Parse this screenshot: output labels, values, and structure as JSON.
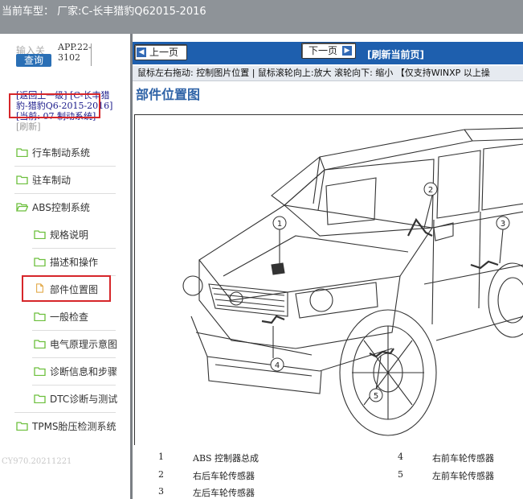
{
  "title_bar": {
    "text": "当前车型： 厂家:C-长丰猎豹Q62015-2016"
  },
  "sidebar": {
    "search_placeholder": "输入关",
    "search_button": "查询",
    "app_code": "APP.22-3102",
    "breadcrumb": {
      "back": "[返回上一级]  [C-长丰猎豹-猎豹Q6-2015-2016]",
      "current": "[当前: 07 制动系统]",
      "refresh": "[刷新]"
    },
    "tree": [
      {
        "label": "行车制动系统",
        "level": 0,
        "type": "folder"
      },
      {
        "label": "驻车制动",
        "level": 0,
        "type": "folder"
      },
      {
        "label": "ABS控制系统",
        "level": 0,
        "type": "folder-open",
        "highlighted": true
      },
      {
        "label": "规格说明",
        "level": 1,
        "type": "folder"
      },
      {
        "label": "描述和操作",
        "level": 1,
        "type": "folder"
      },
      {
        "label": "部件位置图",
        "level": 1,
        "type": "page",
        "highlighted": true
      },
      {
        "label": "一般检查",
        "level": 1,
        "type": "folder"
      },
      {
        "label": "电气原理示意图",
        "level": 1,
        "type": "folder"
      },
      {
        "label": "诊断信息和步骤",
        "level": 1,
        "type": "folder"
      },
      {
        "label": "DTC诊断与测试",
        "level": 1,
        "type": "folder"
      },
      {
        "label": "TPMS胎压检测系统",
        "level": 0,
        "type": "folder"
      }
    ],
    "footer": "CY970.20211221"
  },
  "main": {
    "prev_button": "上一页",
    "next_button": "下一页",
    "refresh_link": "[刷新当前页]",
    "hint": "鼠标左右拖动: 控制图片位置 | 鼠标滚轮向上:放大  滚轮向下: 缩小 【仅支持WINXP 以上操",
    "section_title": "部件位置图",
    "callouts": [
      "1",
      "2",
      "3",
      "4",
      "5"
    ],
    "legend": [
      {
        "num": "1",
        "text": "ABS 控制器总成"
      },
      {
        "num": "2",
        "text": "右后车轮传感器"
      },
      {
        "num": "3",
        "text": "左后车轮传感器"
      },
      {
        "num": "4",
        "text": "右前车轮传感器"
      },
      {
        "num": "5",
        "text": "左前车轮传感器"
      }
    ]
  },
  "colors": {
    "accent": "#2f63a7",
    "highlight": "#d6262a",
    "folder": "#6cbf3c",
    "titlebar": "#8e9398"
  }
}
